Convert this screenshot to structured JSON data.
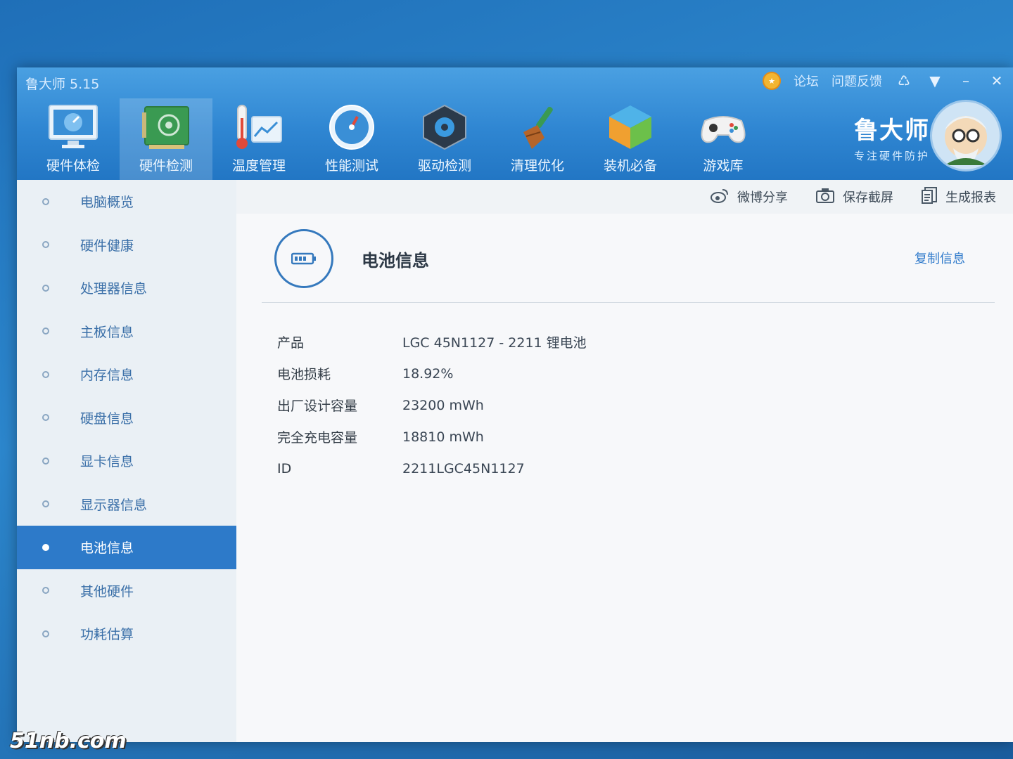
{
  "app": {
    "title": "鲁大师 5.15"
  },
  "top_links": {
    "forum": "论坛",
    "feedback": "问题反馈"
  },
  "window_controls": {
    "skin": "♺",
    "menu": "▼",
    "minimize": "–",
    "close": "✕"
  },
  "toolbar": [
    {
      "label": "硬件体检",
      "icon": "monitor-icon"
    },
    {
      "label": "硬件检测",
      "icon": "circuit-board-icon"
    },
    {
      "label": "温度管理",
      "icon": "thermometer-icon"
    },
    {
      "label": "性能测试",
      "icon": "speedometer-icon"
    },
    {
      "label": "驱动检测",
      "icon": "gear-icon"
    },
    {
      "label": "清理优化",
      "icon": "broom-icon"
    },
    {
      "label": "装机必备",
      "icon": "cube-icon"
    },
    {
      "label": "游戏库",
      "icon": "gamepad-icon"
    }
  ],
  "brand": {
    "name": "鲁大师",
    "slogan": "专注硬件防护"
  },
  "sidebar": {
    "items": [
      {
        "label": "电脑概览"
      },
      {
        "label": "硬件健康"
      },
      {
        "label": "处理器信息"
      },
      {
        "label": "主板信息"
      },
      {
        "label": "内存信息"
      },
      {
        "label": "硬盘信息"
      },
      {
        "label": "显卡信息"
      },
      {
        "label": "显示器信息"
      },
      {
        "label": "电池信息"
      },
      {
        "label": "其他硬件"
      },
      {
        "label": "功耗估算"
      }
    ],
    "active_index": 8
  },
  "actions": {
    "weibo": "微博分享",
    "screenshot": "保存截屏",
    "report": "生成报表"
  },
  "section": {
    "title": "电池信息",
    "copy": "复制信息"
  },
  "battery": [
    {
      "key": "产品",
      "value": "LGC 45N1127 -  2211 锂电池"
    },
    {
      "key": "电池损耗",
      "value": "18.92%"
    },
    {
      "key": "出厂设计容量",
      "value": "23200 mWh"
    },
    {
      "key": "完全充电容量",
      "value": "18810 mWh"
    },
    {
      "key": "ID",
      "value": "2211LGC45N1127"
    }
  ],
  "watermark": "51nb.com",
  "colors": {
    "header": "#2f86d2",
    "active": "#2d7ac9",
    "link": "#2f7acb"
  }
}
